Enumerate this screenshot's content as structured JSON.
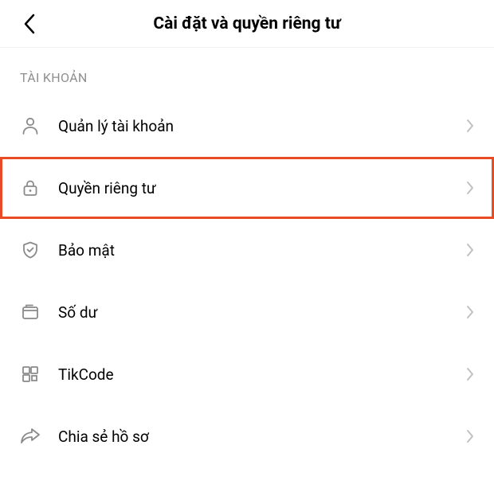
{
  "header": {
    "title": "Cài đặt và quyền riêng tư"
  },
  "section": {
    "label": "TÀI KHOẢN"
  },
  "items": [
    {
      "icon": "user",
      "label": "Quản lý tài khoản",
      "highlighted": false
    },
    {
      "icon": "lock",
      "label": "Quyền riêng tư",
      "highlighted": true
    },
    {
      "icon": "shield",
      "label": "Bảo mật",
      "highlighted": false
    },
    {
      "icon": "wallet",
      "label": "Số dư",
      "highlighted": false
    },
    {
      "icon": "qrcode",
      "label": "TikCode",
      "highlighted": false
    },
    {
      "icon": "share",
      "label": "Chia sẻ hồ sơ",
      "highlighted": false
    }
  ]
}
